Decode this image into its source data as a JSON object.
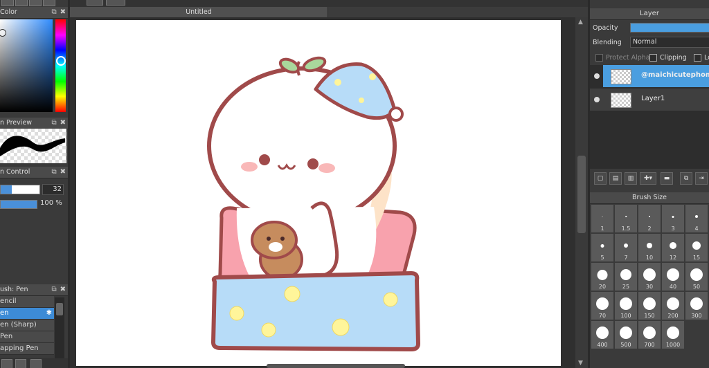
{
  "left": {
    "color_panel": {
      "title": "Color"
    },
    "preview_panel": {
      "title": "n Preview"
    },
    "brush_control": {
      "title": "n Control",
      "size_value": "32",
      "size_fraction": 0.8,
      "opacity_value": "100 %",
      "opacity_fraction": 1.0
    },
    "brush_panel": {
      "title": "ush: Pen",
      "items": [
        "encil",
        "en",
        "en (Sharp)",
        "Pen",
        "apping Pen"
      ],
      "selected_index": 1
    }
  },
  "document": {
    "tab_title": "Untitled"
  },
  "layer_panel": {
    "title": "Layer",
    "opacity_label": "Opacity",
    "blending_label": "Blending",
    "blending_value": "Normal",
    "protect_alpha_label": "Protect Alpha",
    "clipping_label": "Clipping",
    "lock_label": "Lo",
    "layers": [
      {
        "name": "@maichicutephoma",
        "selected": true
      },
      {
        "name": "Layer1",
        "selected": false
      }
    ]
  },
  "brush_size_panel": {
    "title": "Brush Size",
    "sizes": [
      "1",
      "1.5",
      "2",
      "3",
      "4",
      "5",
      "7",
      "10",
      "12",
      "15",
      "20",
      "25",
      "30",
      "40",
      "50",
      "70",
      "100",
      "150",
      "200",
      "300",
      "400",
      "500",
      "700",
      "1000"
    ]
  },
  "colors": {
    "accent": "#3d8bd6",
    "panel": "#3a3a3a",
    "canvas": "#ffffff"
  }
}
